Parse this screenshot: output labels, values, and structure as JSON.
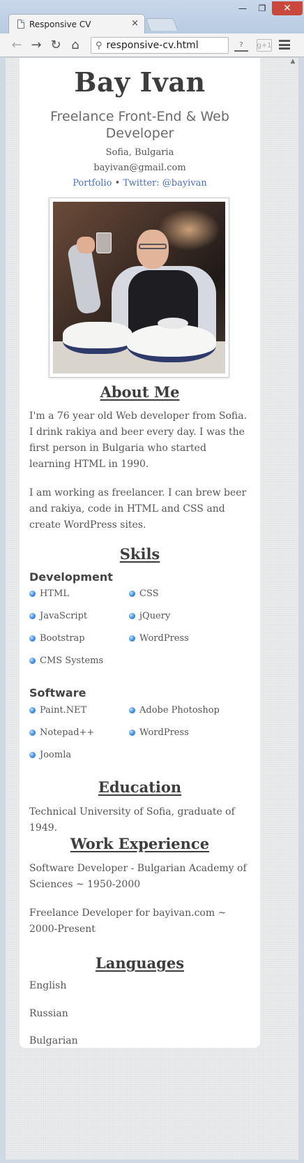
{
  "browser": {
    "tab_title": "Responsive CV",
    "tab_close": "×",
    "url": "responsive-cv.html",
    "window_min": "—",
    "window_max": "❐",
    "window_close": "✕",
    "back": "←",
    "forward": "→",
    "reload": "↻",
    "home": "⌂",
    "search_glyph": "⚲",
    "help_glyph": "?",
    "gplus_glyph": "g+1"
  },
  "cv": {
    "name": "Bay Ivan",
    "headline": "Freelance Front-End & Web Developer",
    "location": "Sofia, Bulgaria",
    "email": "bayivan@gmail.com",
    "link_portfolio": "Portfolio",
    "link_separator": " • ",
    "link_twitter": "Twitter: @bayivan",
    "about": {
      "title": "About Me",
      "p1": "I'm a 76 year old Web developer from Sofia. I drink rakiya and beer every day. I was the first person in Bulgaria who started learning HTML in 1990.",
      "p2": "I am working as freelancer. I can brew beer and rakiya, code in HTML and CSS and create WordPress sites."
    },
    "skills": {
      "title": "Skils",
      "development": {
        "title": "Development",
        "items": [
          "HTML",
          "CSS",
          "JavaScript",
          "jQuery",
          "Bootstrap",
          "WordPress",
          "CMS Systems"
        ]
      },
      "software": {
        "title": "Software",
        "items": [
          "Paint.NET",
          "Adobe Photoshop",
          "Notepad++",
          "WordPress",
          "Joomla"
        ]
      }
    },
    "education": {
      "title": "Education",
      "text": "Technical University of Sofia, graduate of 1949."
    },
    "work": {
      "title": "Work Experience",
      "items": [
        "Software Developer - Bulgarian Academy of Sciences ~ 1950-2000",
        "Freelance Developer for bayivan.com ~ 2000-Present"
      ]
    },
    "languages": {
      "title": "Languages",
      "items": [
        "English",
        "Russian",
        "Bulgarian"
      ]
    }
  }
}
